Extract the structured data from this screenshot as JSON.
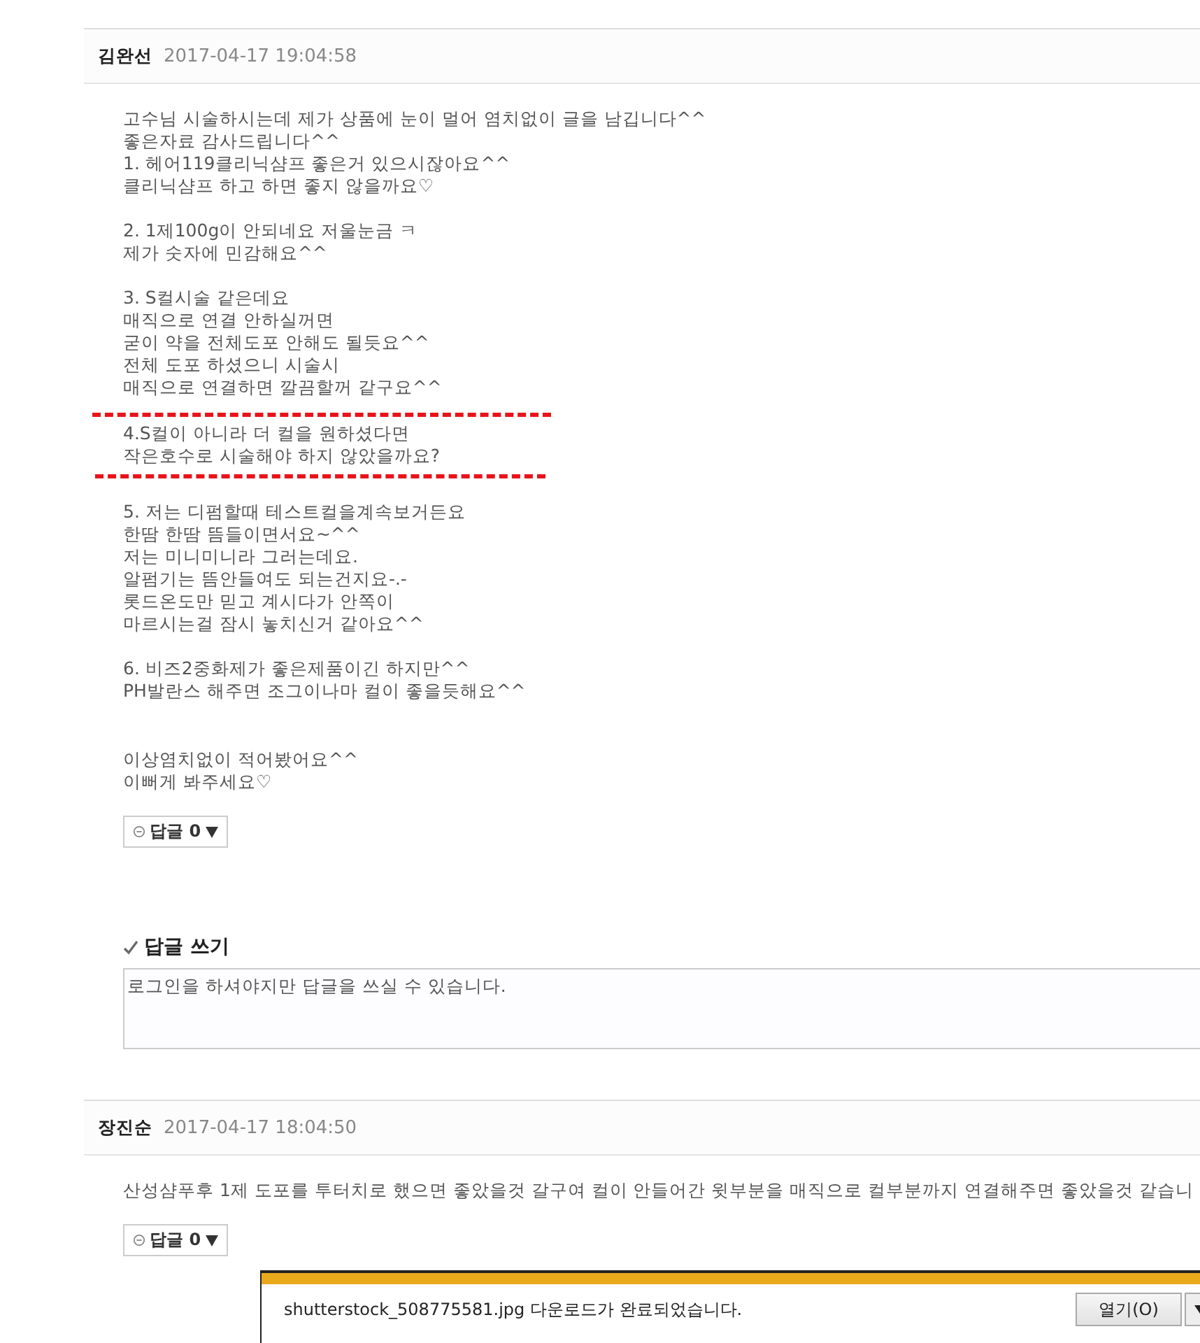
{
  "comments": [
    {
      "author": "김완선",
      "date": "2017-04-17 19:04:58",
      "blocks": [
        {
          "kind": "paragraph",
          "lines": [
            "고수님 시술하시는데 제가 상품에 눈이 멀어 염치없이 글을 남깁니다^^",
            "좋은자료 감사드립니다^^",
            "1. 헤어119클리닉샴프 좋은거 있으시잖아요^^",
            "클리닉샴프 하고 하면 좋지 않을까요♡"
          ]
        },
        {
          "kind": "paragraph",
          "lines": [
            "2. 1제100g이 안되네요 저울눈금 ㅋ",
            "제가 숫자에 민감해요^^"
          ]
        },
        {
          "kind": "paragraph",
          "lines": [
            "3. S컬시술 같은데요",
            "매직으로 연결 안하실꺼면",
            "굳이 약을 전체도포 안해도 될듯요^^",
            "전체 도포 하셨으니 시술시",
            "매직으로 연결하면 깔끔할꺼 같구요^^"
          ]
        },
        {
          "kind": "highlight",
          "lines": [
            "4.S컬이 아니라 더 컬을 원하셨다면",
            "작은호수로 시술해야 하지 않았을까요?"
          ]
        },
        {
          "kind": "paragraph",
          "lines": [
            "5. 저는 디펌할때 테스트컬을계속보거든요",
            "한땀 한땀 뜸들이면서요~^^",
            "저는 미니미니라 그러는데요.",
            "알펌기는 뜸안들여도 되는건지요-.-",
            "롯드온도만 믿고 계시다가 안쪽이",
            "마르시는걸 잠시 놓치신거 같아요^^"
          ]
        },
        {
          "kind": "paragraph",
          "lines": [
            "6. 비즈2중화제가 좋은제품이긴 하지만^^",
            "PH발란스 해주면 조그이나마 컬이 좋을듯해요^^"
          ]
        },
        {
          "kind": "closing",
          "lines": [
            "이상염치없이 적어봤어요^^",
            "이뻐게 봐주세요♡"
          ]
        }
      ],
      "reply_button": {
        "label": "답글",
        "count": "0"
      },
      "reply_form": {
        "title": "답글 쓰기",
        "placeholder": "로그인을 하셔야지만 답글을 쓰실 수 있습니다."
      }
    },
    {
      "author": "장진순",
      "date": "2017-04-17 18:04:50",
      "blocks": [
        {
          "kind": "paragraph",
          "lines": [
            "산성샴푸후 1제 도포를 투터치로 했으면 좋았을것 갈구여 컬이 안들어간 윗부분을 매직으로 컬부분까지 연결해주면 좋았을것 같습니"
          ]
        }
      ],
      "reply_button": {
        "label": "답글",
        "count": "0"
      }
    }
  ],
  "download_bar": {
    "message": "shutterstock_508775581.jpg 다운로드가 완료되었습니다.",
    "open_button": "열기(O)"
  }
}
